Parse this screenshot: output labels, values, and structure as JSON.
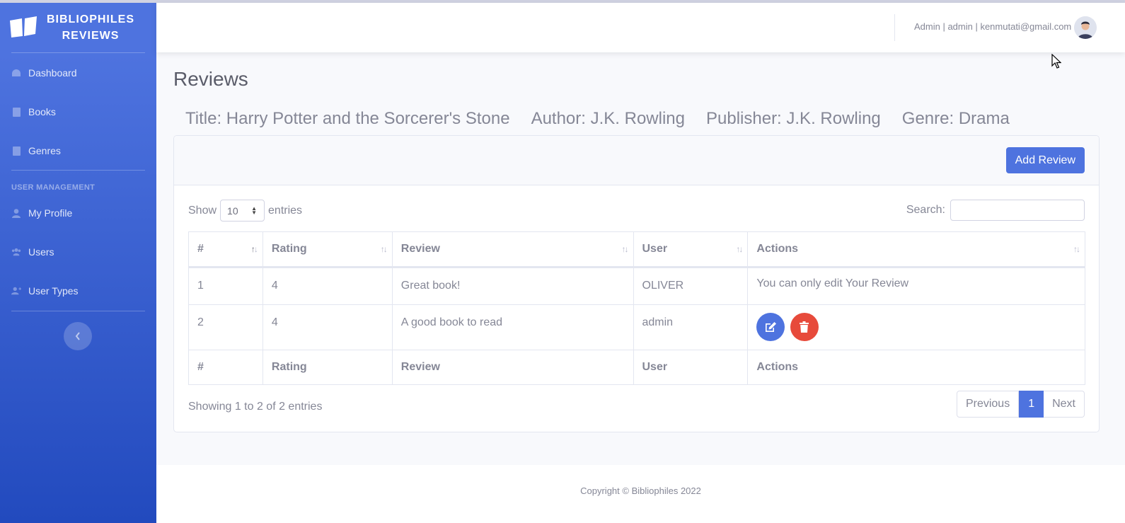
{
  "brand": {
    "line1": "BIBLIOPHILES",
    "line2": "REVIEWS"
  },
  "sidebar": {
    "items": [
      {
        "label": "Dashboard",
        "icon": "tachometer-icon"
      },
      {
        "label": "Books",
        "icon": "book-icon"
      },
      {
        "label": "Genres",
        "icon": "address-book-icon"
      }
    ],
    "heading": "USER MANAGEMENT",
    "user_items": [
      {
        "label": "My Profile",
        "icon": "user-icon"
      },
      {
        "label": "Users",
        "icon": "users-icon"
      },
      {
        "label": "User Types",
        "icon": "user-plus-icon"
      }
    ]
  },
  "topbar": {
    "user_info": "Admin | admin | kenmutati@gmail.com"
  },
  "page": {
    "title": "Reviews",
    "book": {
      "title": "Title: Harry Potter and the Sorcerer's Stone",
      "author": "Author: J.K. Rowling",
      "publisher": "Publisher: J.K. Rowling",
      "genre": "Genre: Drama"
    }
  },
  "card": {
    "add_button": "Add Review",
    "show_label": "Show",
    "entries_label": "entries",
    "length_value": "10",
    "search_label": "Search:",
    "columns": [
      "#",
      "Rating",
      "Review",
      "User",
      "Actions"
    ],
    "rows": [
      {
        "num": "1",
        "rating": "4",
        "review": "Great book!",
        "user": "OLIVER",
        "actions_note": "You can only edit Your Review"
      },
      {
        "num": "2",
        "rating": "4",
        "review": "A good book to read",
        "user": "admin",
        "actions_note": ""
      }
    ],
    "info": "Showing 1 to 2 of 2 entries",
    "pager": {
      "prev": "Previous",
      "current": "1",
      "next": "Next"
    }
  },
  "footer": {
    "copyright": "Copyright © Bibliophiles 2022"
  },
  "colors": {
    "primary": "#4e73df",
    "danger": "#e74a3b",
    "sidebar_bottom": "#224abe"
  }
}
